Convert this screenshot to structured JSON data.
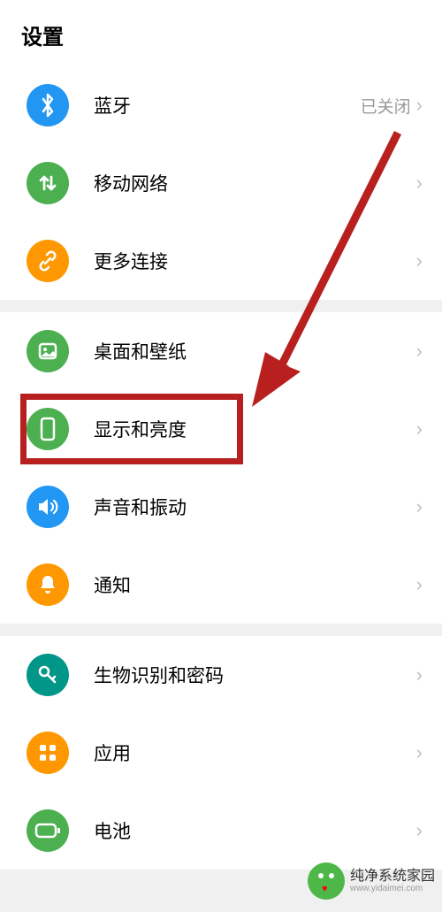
{
  "header": {
    "title": "设置"
  },
  "sections": [
    {
      "items": [
        {
          "name": "bluetooth",
          "label": "蓝牙",
          "value": "已关闭",
          "iconColor": "#2196f3",
          "icon": "bluetooth"
        },
        {
          "name": "mobile-network",
          "label": "移动网络",
          "value": "",
          "iconColor": "#4caf50",
          "icon": "updown"
        },
        {
          "name": "more-connections",
          "label": "更多连接",
          "value": "",
          "iconColor": "#ff9800",
          "icon": "link"
        }
      ]
    },
    {
      "items": [
        {
          "name": "wallpaper",
          "label": "桌面和壁纸",
          "value": "",
          "iconColor": "#4caf50",
          "icon": "image"
        },
        {
          "name": "display-brightness",
          "label": "显示和亮度",
          "value": "",
          "iconColor": "#4caf50",
          "icon": "phone",
          "highlighted": true
        },
        {
          "name": "sound-vibration",
          "label": "声音和振动",
          "value": "",
          "iconColor": "#2196f3",
          "icon": "sound"
        },
        {
          "name": "notifications",
          "label": "通知",
          "value": "",
          "iconColor": "#ff9800",
          "icon": "bell"
        }
      ]
    },
    {
      "items": [
        {
          "name": "biometrics-password",
          "label": "生物识别和密码",
          "value": "",
          "iconColor": "#009688",
          "icon": "key"
        },
        {
          "name": "apps",
          "label": "应用",
          "value": "",
          "iconColor": "#ff9800",
          "icon": "grid"
        },
        {
          "name": "battery",
          "label": "电池",
          "value": "",
          "iconColor": "#4caf50",
          "icon": "battery"
        }
      ]
    }
  ],
  "watermark": {
    "cn": "纯净系统家园",
    "en": "www.yidaimei.com"
  },
  "annotation": {
    "arrowColor": "#b82020",
    "highlightColor": "#b82020"
  }
}
